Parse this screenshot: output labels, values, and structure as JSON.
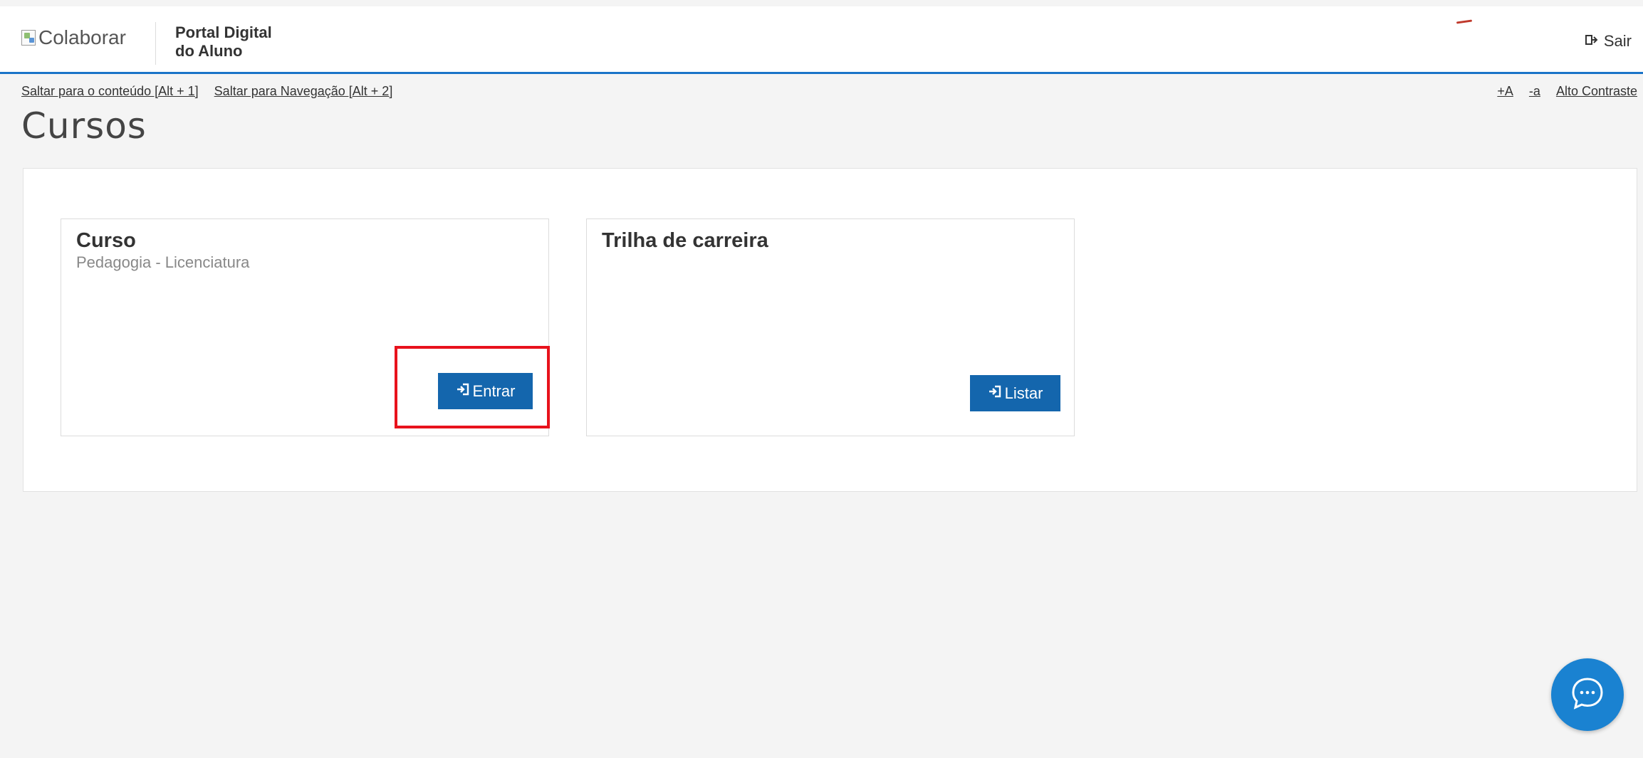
{
  "header": {
    "logo_alt": "Colaborar",
    "portal_title_line1": "Portal Digital",
    "portal_title_line2": "do Aluno",
    "logout_label": "Sair",
    "logout_icon": "sign-out-icon",
    "accent_color": "#1a73c8"
  },
  "accessibility": {
    "skip_content": "Saltar para o conteúdo [Alt + 1]",
    "skip_nav": "Saltar para Navegação [Alt + 2]",
    "increase_font": "+A",
    "decrease_font": "-a",
    "high_contrast": "Alto Contraste"
  },
  "page": {
    "title": "Cursos"
  },
  "cards": [
    {
      "title": "Curso",
      "subtitle": "Pedagogia - Licenciatura",
      "button_label": "Entrar",
      "button_icon": "sign-in-icon"
    },
    {
      "title": "Trilha de carreira",
      "subtitle": "",
      "button_label": "Listar",
      "button_icon": "sign-in-icon"
    }
  ],
  "chat": {
    "icon": "chat-bubble-icon",
    "color": "#1a82d1"
  },
  "colors": {
    "button_bg": "#1466ad",
    "highlight": "#e8121c"
  }
}
